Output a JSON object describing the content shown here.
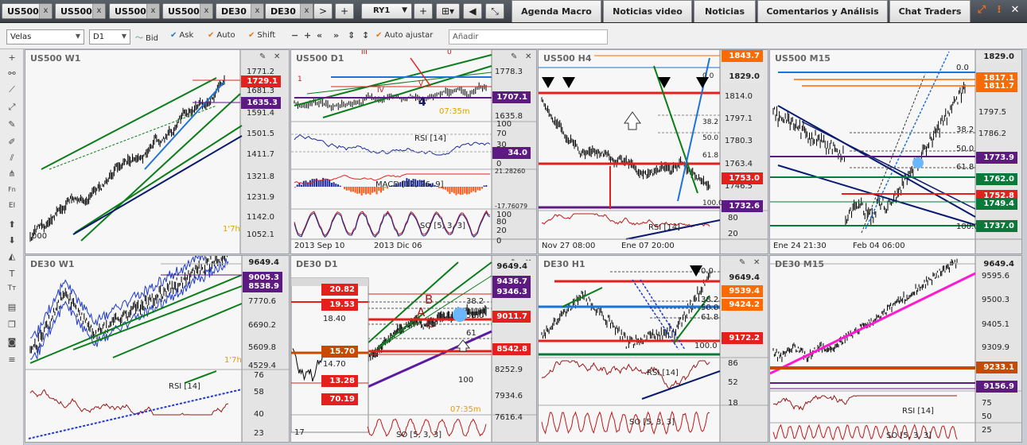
{
  "tabs": {
    "symbols": [
      {
        "label": "US500"
      },
      {
        "label": "US500"
      },
      {
        "label": "US500"
      },
      {
        "label": "US500"
      },
      {
        "label": "DE30"
      },
      {
        "label": "DE30"
      }
    ],
    "close_glyph": "x",
    "next_glyph": ">",
    "add_glyph": "+",
    "layout_label": "RY1",
    "nav": [
      {
        "label": "Agenda Macro"
      },
      {
        "label": "Noticias video"
      },
      {
        "label": "Noticias"
      },
      {
        "label": "Comentarios y Análisis"
      },
      {
        "label": "Chat Traders"
      }
    ]
  },
  "toolbar": {
    "chart_type": "Velas",
    "timeframe": "D1",
    "bid": "Bid",
    "ask": "Ask",
    "auto": "Auto",
    "shift": "Shift",
    "auto_adjust": "Auto ajustar",
    "add_placeholder": "Añadir"
  },
  "panels": {
    "p1": {
      "title": "US500 W1",
      "axis": [
        "1771.2",
        "1681.3",
        "1591.4",
        "1501.5",
        "1411.7",
        "1321.8",
        "1231.9",
        "1142.0",
        "1052.1"
      ],
      "tags": [
        {
          "text": "1729.1",
          "color": "#e3201c"
        },
        {
          "text": "1635.3",
          "color": "#5c1a82"
        }
      ],
      "mini": "1'7h",
      "date": "000"
    },
    "p2": {
      "title": "US500 D1",
      "axis": [
        "1778.3",
        "1635.8"
      ],
      "tags": [
        {
          "text": "1707.1",
          "color": "#5c1a82"
        }
      ],
      "rsi_label": "RSI [14]",
      "rsi_axis": [
        "100",
        "70",
        "30",
        "0"
      ],
      "rsi_tag": "34.0",
      "macd_label": "MACD [12, 26, 9]",
      "macd_axis": [
        "21.28260",
        "-17.76079"
      ],
      "so_label": "SO [5, 3, 3]",
      "so_axis": [
        "100",
        "80",
        "20",
        "0"
      ],
      "mini": "07:35m",
      "dates": [
        "2013 Sep 10",
        "2013 Dic 06"
      ],
      "wave_label": "4",
      "pattern_labels": [
        "III",
        "1",
        "IV",
        "V",
        "0"
      ]
    },
    "p3": {
      "title": "US500 H4",
      "axis": [
        "1814.0",
        "1797.1",
        "1780.3",
        "1763.4",
        "1746.5"
      ],
      "tags": [
        {
          "text": "1843.7",
          "color": "#ff6a00"
        },
        {
          "text": "1829.0",
          "color": "#e6e6e6",
          "fg": "#222"
        },
        {
          "text": "1753.0",
          "color": "#e3201c"
        },
        {
          "text": "1732.6",
          "color": "#5c1a82"
        }
      ],
      "fib": [
        "0.0",
        "38.2",
        "50.0",
        "61.8",
        "100.0"
      ],
      "rsi_label": "RSI [14]",
      "rsi_axis": [
        "80",
        "20"
      ],
      "dates": [
        "Nov 27 08:00",
        "Ene 07 20:00"
      ]
    },
    "p4": {
      "title": "US500 M15",
      "axis": [
        "1797.5",
        "1786.2"
      ],
      "tags": [
        {
          "text": "1829.0",
          "color": "#e6e6e6",
          "fg": "#222"
        },
        {
          "text": "1817.1",
          "color": "#ff6a00"
        },
        {
          "text": "1811.7",
          "color": "#ff6a00"
        },
        {
          "text": "1773.9",
          "color": "#5c1a82"
        },
        {
          "text": "1762.0",
          "color": "#0a7a3a"
        },
        {
          "text": "1752.8",
          "color": "#e3201c"
        },
        {
          "text": "1749.4",
          "color": "#0a7a3a"
        },
        {
          "text": "1737.0",
          "color": "#0a7a3a"
        }
      ],
      "fib": [
        "0.0",
        "38.2",
        "50.0",
        "61.8",
        "100.0"
      ],
      "dates": [
        "Ene 24 21:30",
        "Feb 04 06:00"
      ]
    },
    "p5": {
      "title": "DE30 W1",
      "axis": [
        "7770.6",
        "6690.2",
        "5609.8",
        "4529.4"
      ],
      "tags": [
        {
          "text": "9649.4",
          "color": "#e6e6e6",
          "fg": "#222"
        },
        {
          "text": "9005.3",
          "color": "#5c1a82"
        },
        {
          "text": "8538.9",
          "color": "#5c1a82"
        }
      ],
      "rsi_label": "RSI [14]",
      "rsi_axis": [
        "76",
        "58",
        "40",
        "23"
      ],
      "mini": "1'7h"
    },
    "p6": {
      "title": "DE30 D1",
      "axis": [
        "18.40",
        "14.70",
        "8252.9",
        "7934.6",
        "7616.4"
      ],
      "tags": [
        {
          "text": "20.82",
          "color": "#e3201c"
        },
        {
          "text": "19.53",
          "color": "#e3201c"
        },
        {
          "text": "15.70",
          "color": "#c84a00"
        },
        {
          "text": "13.28",
          "color": "#e3201c"
        },
        {
          "text": "70.19",
          "color": "#e3201c"
        },
        {
          "text": "9649.4",
          "color": "#e6e6e6",
          "fg": "#222"
        },
        {
          "text": "9436.7",
          "color": "#5c1a82"
        },
        {
          "text": "9346.3",
          "color": "#5c1a82"
        },
        {
          "text": "9011.7",
          "color": "#e3201c"
        },
        {
          "text": "8542.8",
          "color": "#e3201c"
        }
      ],
      "fib": [
        "38.2",
        "50.0",
        "61",
        "100"
      ],
      "so_label": "SO [5, 3, 3]",
      "mini": "07:35m",
      "date": "17",
      "pattern_labels": [
        "A",
        "B",
        "C"
      ]
    },
    "p7": {
      "title": "DE30 H1",
      "axis": [
        "86",
        "52",
        "18"
      ],
      "tags": [
        {
          "text": "9649.4",
          "color": "#e6e6e6",
          "fg": "#222"
        },
        {
          "text": "9539.4",
          "color": "#ff6a00"
        },
        {
          "text": "9424.2",
          "color": "#ff6a00"
        },
        {
          "text": "9172.2",
          "color": "#e3201c"
        }
      ],
      "fib": [
        "0.0",
        "38.2",
        "50.0",
        "61.8",
        "100.0"
      ],
      "rsi_label": "RSI [14]",
      "so_label": "SO [5, 3, 3]"
    },
    "p8": {
      "title": "DE30 M15",
      "axis": [
        "9595.6",
        "9500.3",
        "9405.1",
        "9309.9",
        "75",
        "50",
        "25"
      ],
      "tags": [
        {
          "text": "9649.4",
          "color": "#e6e6e6",
          "fg": "#222"
        },
        {
          "text": "9233.1",
          "color": "#c84a00"
        },
        {
          "text": "9156.9",
          "color": "#5c1a82"
        }
      ],
      "rsi_label": "RSI [14]",
      "so_label": "SO [5, 3, 3]"
    }
  }
}
